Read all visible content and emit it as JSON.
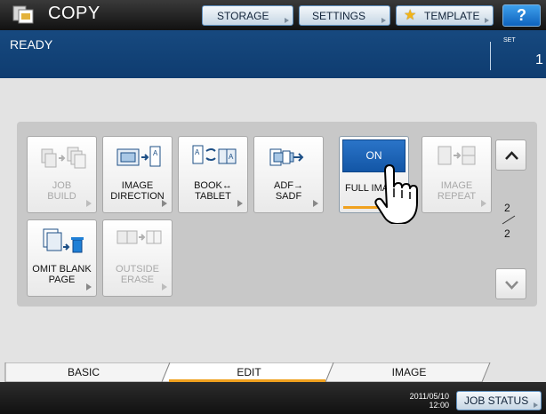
{
  "header": {
    "title": "COPY",
    "buttons": {
      "storage": "STORAGE",
      "settings": "SETTINGS",
      "template": "TEMPLATE",
      "help": "?"
    }
  },
  "status": {
    "text": "READY",
    "set_label": "SET",
    "set_value": "1"
  },
  "functions": [
    {
      "line1": "JOB",
      "line2": "BUILD",
      "enabled": false,
      "icon": "job-build-icon"
    },
    {
      "line1": "IMAGE",
      "line2": "DIRECTION",
      "enabled": true,
      "icon": "image-direction-icon"
    },
    {
      "line1": "BOOK↔",
      "line2": "TABLET",
      "enabled": true,
      "icon": "book-tablet-icon"
    },
    {
      "line1": "ADF→",
      "line2": "SADF",
      "enabled": true,
      "icon": "adf-sadf-icon"
    },
    {
      "on_label": "ON",
      "line1": "FULL IMAGE",
      "enabled": true,
      "selected": true
    },
    {
      "line1": "IMAGE",
      "line2": "REPEAT",
      "enabled": false,
      "icon": "image-repeat-icon"
    },
    {
      "line1": "OMIT BLANK",
      "line2": "PAGE",
      "enabled": true,
      "icon": "omit-blank-page-icon"
    },
    {
      "line1": "OUTSIDE",
      "line2": "ERASE",
      "enabled": false,
      "icon": "outside-erase-icon"
    }
  ],
  "pagination": {
    "current": "2",
    "total": "2"
  },
  "tabs": [
    {
      "label": "BASIC",
      "active": false
    },
    {
      "label": "EDIT",
      "active": true
    },
    {
      "label": "IMAGE",
      "active": false
    }
  ],
  "footer": {
    "date": "2011/05/10",
    "time": "12:00",
    "job_status": "JOB STATUS"
  },
  "colors": {
    "accent_blue": "#1356a6",
    "status_bar": "#0e3c70",
    "tab_indicator": "#f0a11e",
    "star": "#f2b418"
  }
}
